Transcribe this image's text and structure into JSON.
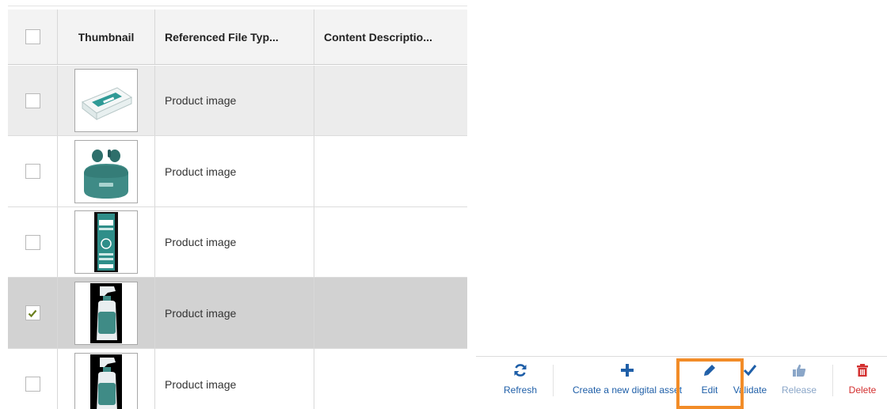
{
  "grid": {
    "headers": {
      "thumbnail": "Thumbnail",
      "file_type": "Referenced File Typ...",
      "content_description": "Content Descriptio..."
    },
    "rows": [
      {
        "file_type": "Product image",
        "checked": false,
        "thumbnail": "box-product-thumbnail"
      },
      {
        "file_type": "Product image",
        "checked": false,
        "thumbnail": "earbuds-case-thumbnail"
      },
      {
        "file_type": "Product image",
        "checked": false,
        "thumbnail": "tall-box-thumbnail"
      },
      {
        "file_type": "Product image",
        "checked": true,
        "thumbnail": "spray-bottle-thumbnail"
      },
      {
        "file_type": "Product image",
        "checked": false,
        "thumbnail": "spray-bottle-thumbnail"
      }
    ]
  },
  "toolbar": {
    "refresh": {
      "label": "Refresh",
      "icon": "refresh-icon"
    },
    "create": {
      "label": "Create a new digital asset",
      "icon": "plus-icon"
    },
    "edit": {
      "label": "Edit",
      "icon": "pencil-icon"
    },
    "validate": {
      "label": "Validate",
      "icon": "checkmark-icon"
    },
    "release": {
      "label": "Release",
      "icon": "thumbs-up-icon"
    },
    "delete": {
      "label": "Delete",
      "icon": "trash-icon"
    }
  },
  "colors": {
    "accent": "#1f5fa8",
    "highlight": "#f28c28",
    "danger": "#d32f2f",
    "selected_row": "#d2d2d2",
    "alt_row": "#ececec",
    "checkmark": "#6b7f1e"
  }
}
